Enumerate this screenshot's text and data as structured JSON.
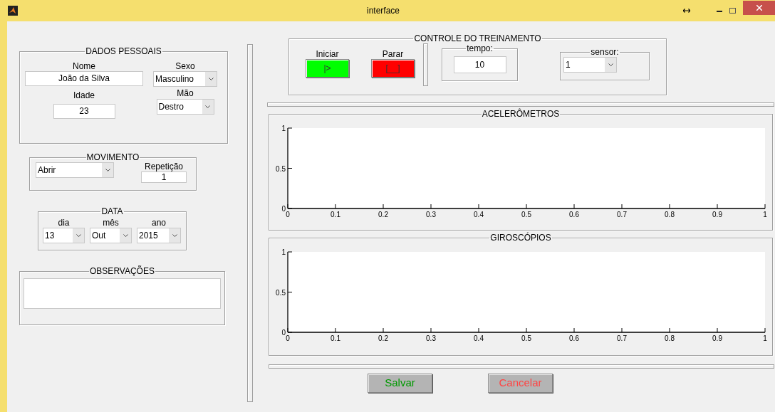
{
  "window": {
    "title": "interface"
  },
  "personal": {
    "title": "DADOS PESSOAIS",
    "name_label": "Nome",
    "name_value": "João da Silva",
    "sex_label": "Sexo",
    "sex_value": "Masculino",
    "age_label": "Idade",
    "age_value": "23",
    "hand_label": "Mão",
    "hand_value": "Destro"
  },
  "movement": {
    "title": "MOVIMENTO",
    "value": "Abrir",
    "reps_label": "Repetição",
    "reps_value": "1"
  },
  "date": {
    "title": "DATA",
    "fields": [
      {
        "label": "dia",
        "value": "13"
      },
      {
        "label": "mês",
        "value": "Out"
      },
      {
        "label": "ano",
        "value": "2015"
      }
    ]
  },
  "notes": {
    "title": "OBSERVAÇÕES"
  },
  "control": {
    "title": "CONTROLE DO TREINAMENTO",
    "buttons": [
      {
        "label": "Iniciar",
        "symbol": "|>",
        "color": "#00ff00"
      },
      {
        "label": "Parar",
        "symbol": "[__]",
        "color": "#ff0000"
      }
    ],
    "time": {
      "label": "tempo:",
      "value": "10"
    },
    "sensor": {
      "label": "sensor:",
      "value": "1"
    }
  },
  "charts": [
    {
      "title": "ACELERÔMETROS",
      "chart_data": {
        "type": "line",
        "xlim": [
          0,
          1
        ],
        "ylim": [
          0,
          1
        ],
        "xticks": [
          0,
          0.1,
          0.2,
          0.3,
          0.4,
          0.5,
          0.6,
          0.7,
          0.8,
          0.9,
          1
        ],
        "yticks": [
          0,
          0.5,
          1
        ]
      }
    },
    {
      "title": "GIROSCÓPIOS",
      "chart_data": {
        "type": "line",
        "xlim": [
          0,
          1
        ],
        "ylim": [
          0,
          1
        ],
        "xticks": [
          0,
          0.1,
          0.2,
          0.3,
          0.4,
          0.5,
          0.6,
          0.7,
          0.8,
          0.9,
          1
        ],
        "yticks": [
          0,
          0.5,
          1
        ]
      }
    }
  ],
  "actions": [
    {
      "label": "Salvar",
      "color": "#009900"
    },
    {
      "label": "Cancelar",
      "color": "#ff4444"
    }
  ]
}
